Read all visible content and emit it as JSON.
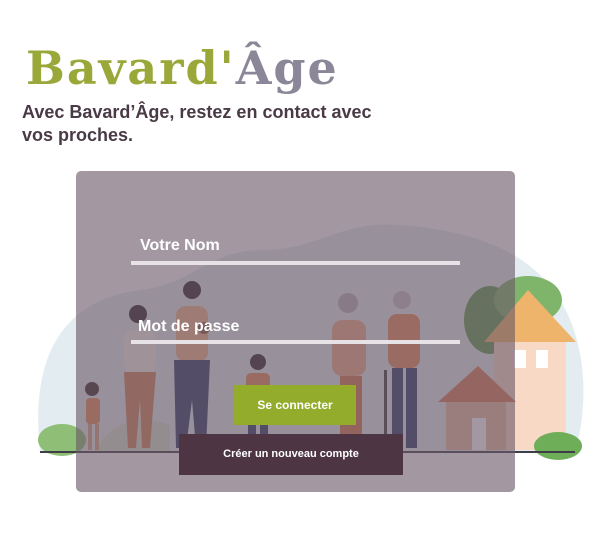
{
  "header": {
    "logo_part1": "Bavard'",
    "logo_part2": "Âge",
    "tagline": "Avec Bavard’Âge, restez en contact avec vos proches."
  },
  "form": {
    "name_label": "Votre Nom",
    "password_label": "Mot de passe",
    "login_button": "Se connecter",
    "create_account_button": "Créer un nouveau compte"
  },
  "colors": {
    "brand_green": "#9aa83a",
    "brand_grey": "#8c8798",
    "button_green": "#94ac2c",
    "button_dark": "#4d3544"
  }
}
